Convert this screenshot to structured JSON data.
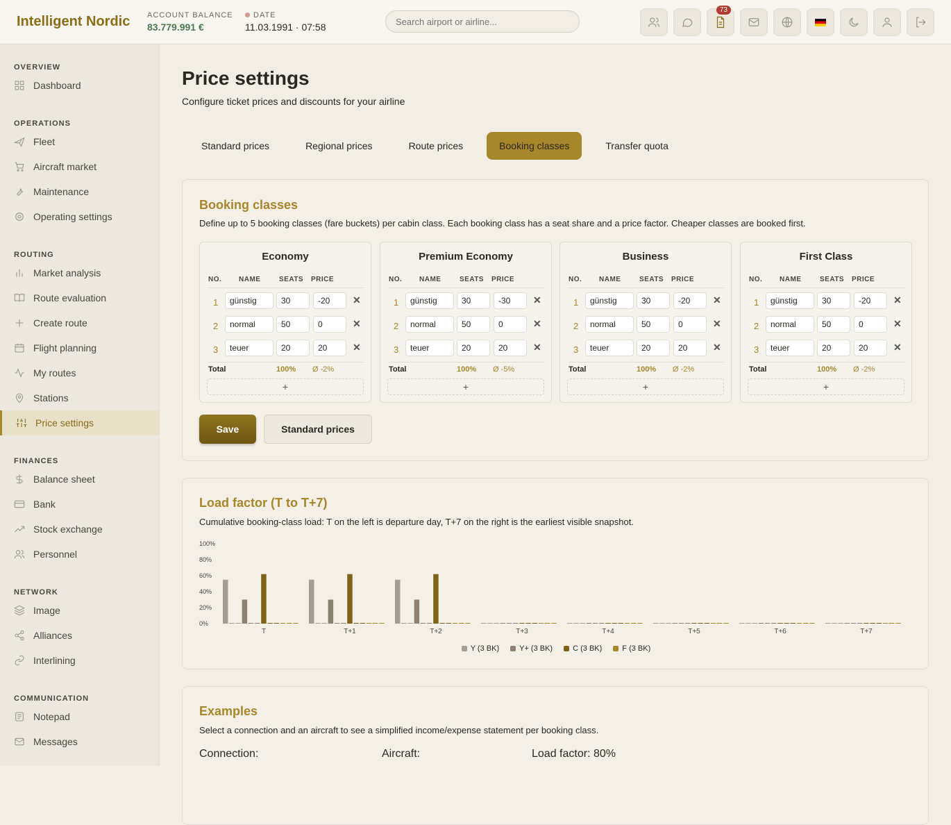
{
  "header": {
    "brand": "Intelligent Nordic",
    "balance_label": "ACCOUNT BALANCE",
    "balance_value": "83.779.991 €",
    "date_label": "DATE",
    "date_value": "11.03.1991 · 07:58",
    "search_placeholder": "Search airport or airline...",
    "notification_count": "73"
  },
  "sidebar": {
    "sections": [
      {
        "title": "OVERVIEW",
        "items": [
          {
            "label": "Dashboard",
            "icon": "dashboard-icon"
          }
        ]
      },
      {
        "title": "OPERATIONS",
        "items": [
          {
            "label": "Fleet",
            "icon": "plane-icon"
          },
          {
            "label": "Aircraft market",
            "icon": "cart-icon"
          },
          {
            "label": "Maintenance",
            "icon": "wrench-icon"
          },
          {
            "label": "Operating settings",
            "icon": "gear-icon"
          }
        ]
      },
      {
        "title": "ROUTING",
        "items": [
          {
            "label": "Market analysis",
            "icon": "bar-chart-icon"
          },
          {
            "label": "Route evaluation",
            "icon": "book-icon"
          },
          {
            "label": "Create route",
            "icon": "plus-icon"
          },
          {
            "label": "Flight planning",
            "icon": "calendar-icon"
          },
          {
            "label": "My routes",
            "icon": "activity-icon"
          },
          {
            "label": "Stations",
            "icon": "map-pin-icon"
          },
          {
            "label": "Price settings",
            "icon": "sliders-icon",
            "active": true
          }
        ]
      },
      {
        "title": "FINANCES",
        "items": [
          {
            "label": "Balance sheet",
            "icon": "dollar-icon"
          },
          {
            "label": "Bank",
            "icon": "credit-card-icon"
          },
          {
            "label": "Stock exchange",
            "icon": "trending-up-icon"
          },
          {
            "label": "Personnel",
            "icon": "users-icon"
          }
        ]
      },
      {
        "title": "NETWORK",
        "items": [
          {
            "label": "Image",
            "icon": "layers-icon"
          },
          {
            "label": "Alliances",
            "icon": "share-icon"
          },
          {
            "label": "Interlining",
            "icon": "link-icon"
          }
        ]
      },
      {
        "title": "COMMUNICATION",
        "items": [
          {
            "label": "Notepad",
            "icon": "notepad-icon"
          },
          {
            "label": "Messages",
            "icon": "mail-icon"
          }
        ]
      }
    ]
  },
  "page": {
    "title": "Price settings",
    "subtitle": "Configure ticket prices and discounts for your airline",
    "tabs": [
      "Standard prices",
      "Regional prices",
      "Route prices",
      "Booking classes",
      "Transfer quota"
    ],
    "active_tab": "Booking classes"
  },
  "booking": {
    "title": "Booking classes",
    "description": "Define up to 5 booking classes (fare buckets) per cabin class. Each booking class has a seat share and a price factor. Cheaper classes are booked first.",
    "col_headers": [
      "NO.",
      "NAME",
      "SEATS",
      "PRICE"
    ],
    "total_label": "Total",
    "add_label": "+",
    "cabins": [
      {
        "name": "Economy",
        "rows": [
          {
            "no": "1",
            "name": "günstig",
            "seats": "30",
            "price": "-20"
          },
          {
            "no": "2",
            "name": "normal",
            "seats": "50",
            "price": "0"
          },
          {
            "no": "3",
            "name": "teuer",
            "seats": "20",
            "price": "20"
          }
        ],
        "total_seats": "100%",
        "avg_price": "Ø -2%"
      },
      {
        "name": "Premium Economy",
        "rows": [
          {
            "no": "1",
            "name": "günstig",
            "seats": "30",
            "price": "-30"
          },
          {
            "no": "2",
            "name": "normal",
            "seats": "50",
            "price": "0"
          },
          {
            "no": "3",
            "name": "teuer",
            "seats": "20",
            "price": "20"
          }
        ],
        "total_seats": "100%",
        "avg_price": "Ø -5%"
      },
      {
        "name": "Business",
        "rows": [
          {
            "no": "1",
            "name": "günstig",
            "seats": "30",
            "price": "-20"
          },
          {
            "no": "2",
            "name": "normal",
            "seats": "50",
            "price": "0"
          },
          {
            "no": "3",
            "name": "teuer",
            "seats": "20",
            "price": "20"
          }
        ],
        "total_seats": "100%",
        "avg_price": "Ø -2%"
      },
      {
        "name": "First Class",
        "rows": [
          {
            "no": "1",
            "name": "günstig",
            "seats": "30",
            "price": "-20"
          },
          {
            "no": "2",
            "name": "normal",
            "seats": "50",
            "price": "0"
          },
          {
            "no": "3",
            "name": "teuer",
            "seats": "20",
            "price": "20"
          }
        ],
        "total_seats": "100%",
        "avg_price": "Ø -2%"
      }
    ],
    "save_label": "Save",
    "standard_label": "Standard prices"
  },
  "load": {
    "title": "Load factor (T to T+7)",
    "description": "Cumulative booking-class load: T on the left is departure day, T+7 on the right is the earliest visible snapshot."
  },
  "chart_data": {
    "type": "bar",
    "categories": [
      "T",
      "T+1",
      "T+2",
      "T+3",
      "T+4",
      "T+5",
      "T+6",
      "T+7"
    ],
    "y_ticks": [
      "0%",
      "20%",
      "40%",
      "60%",
      "80%",
      "100%"
    ],
    "ylim": [
      0,
      100
    ],
    "grid": false,
    "legend_position": "bottom",
    "series": [
      {
        "name": "Y (3 BK)",
        "color": "#a39e94",
        "values": [
          [
            55,
            0,
            0
          ],
          [
            55,
            0,
            0
          ],
          [
            55,
            0,
            0
          ],
          [
            0,
            0,
            0
          ],
          [
            0,
            0,
            0
          ],
          [
            0,
            0,
            0
          ],
          [
            0,
            0,
            0
          ],
          [
            0,
            0,
            0
          ]
        ]
      },
      {
        "name": "Y+ (3 BK)",
        "color": "#8c8170",
        "values": [
          [
            30,
            0,
            0
          ],
          [
            30,
            0,
            0
          ],
          [
            30,
            0,
            0
          ],
          [
            0,
            0,
            0
          ],
          [
            0,
            0,
            0
          ],
          [
            0,
            0,
            0
          ],
          [
            0,
            0,
            0
          ],
          [
            0,
            0,
            0
          ]
        ]
      },
      {
        "name": "C (3 BK)",
        "color": "#7d6218",
        "values": [
          [
            62,
            0,
            0
          ],
          [
            62,
            0,
            0
          ],
          [
            62,
            0,
            0
          ],
          [
            0,
            0,
            0
          ],
          [
            0,
            0,
            0
          ],
          [
            0,
            0,
            0
          ],
          [
            0,
            0,
            0
          ],
          [
            0,
            0,
            0
          ]
        ]
      },
      {
        "name": "F (3 BK)",
        "color": "#a8862a",
        "values": [
          [
            0,
            0,
            0
          ],
          [
            0,
            0,
            0
          ],
          [
            0,
            0,
            0
          ],
          [
            0,
            0,
            0
          ],
          [
            0,
            0,
            0
          ],
          [
            0,
            0,
            0
          ],
          [
            0,
            0,
            0
          ],
          [
            0,
            0,
            0
          ]
        ]
      }
    ]
  },
  "examples": {
    "title": "Examples",
    "description": "Select a connection and an aircraft to see a simplified income/expense statement per booking class.",
    "connection_label": "Connection:",
    "aircraft_label": "Aircraft:",
    "load_label": "Load factor: 80%"
  }
}
